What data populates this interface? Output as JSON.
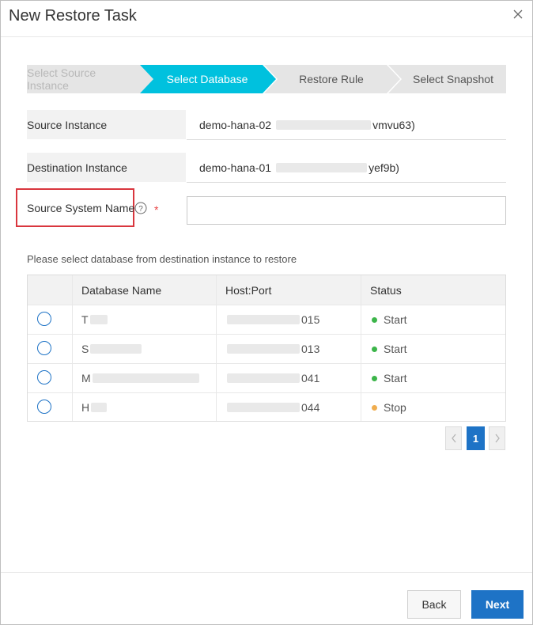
{
  "dialog": {
    "title": "New Restore Task",
    "close_icon": "close-icon"
  },
  "steps": [
    {
      "label": "Select Source Instance",
      "state": "done"
    },
    {
      "label": "Select Database",
      "state": "active"
    },
    {
      "label": "Restore Rule",
      "state": "pending"
    },
    {
      "label": "Select Snapshot",
      "state": "pending"
    }
  ],
  "colors": {
    "step_active": "#00c1de",
    "step_inactive": "#e5e5e5",
    "primary": "#1e73c6",
    "required": "#e84142",
    "highlight_box": "#d9363e",
    "status_start": "#3cb54a",
    "status_stop": "#f0ad4e"
  },
  "form": {
    "source_instance": {
      "label": "Source Instance",
      "value_prefix": "demo-hana-02",
      "value_suffix": "vmvu63)"
    },
    "destination_instance": {
      "label": "Destination Instance",
      "value_prefix": "demo-hana-01",
      "value_suffix": "yef9b)"
    },
    "source_system_name": {
      "label": "Source System Name",
      "help_icon": "question-circle-icon",
      "required_mark": "*",
      "value": "",
      "placeholder": ""
    }
  },
  "table": {
    "hint": "Please select database from destination instance to restore",
    "headers": [
      "Database Name",
      "Host:Port",
      "Status"
    ],
    "rows": [
      {
        "name_prefix": "T",
        "port_suffix": "015",
        "status": "Start"
      },
      {
        "name_prefix": "S",
        "port_suffix": "013",
        "status": "Start"
      },
      {
        "name_prefix": "M",
        "port_suffix": "041",
        "status": "Start"
      },
      {
        "name_prefix": "H",
        "port_suffix": "044",
        "status": "Stop"
      }
    ]
  },
  "pagination": {
    "current_page": "1"
  },
  "footer": {
    "back_label": "Back",
    "next_label": "Next"
  }
}
